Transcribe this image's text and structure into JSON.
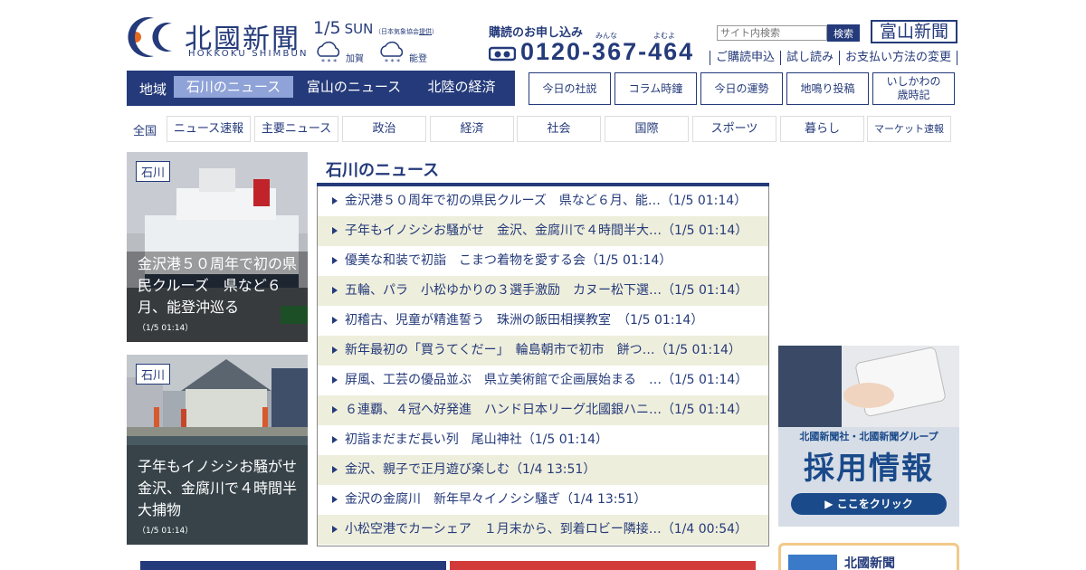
{
  "header": {
    "logo_title": "北國新聞",
    "logo_roman": "HOKKOKU SHIMBUN",
    "date": "1/5",
    "day_of_week": "SUN",
    "weather_note_prefix": "（日本気象協会",
    "weather_note_link": "提供",
    "weather_note_suffix": "）",
    "weather": [
      {
        "area": "加賀",
        "icon": "cloud-snow-icon"
      },
      {
        "area": "能登",
        "icon": "cloud-snow-icon"
      }
    ],
    "subscription_label": "購読のお申し込み",
    "phone_ruby_left": "みんな",
    "phone_ruby_right": "よむよ",
    "phone_icon": "freedial-icon",
    "phone_number": "0120-367-464",
    "search_placeholder": "サイト内検索",
    "search_button": "検索",
    "toyama_button": "富山新聞",
    "sub_links": [
      "ご購読申込",
      "試し読み",
      "お支払い方法の変更"
    ]
  },
  "region_nav": {
    "label": "地域",
    "tabs": [
      {
        "label": "石川のニュース",
        "active": true
      },
      {
        "label": "富山のニュース",
        "active": false
      },
      {
        "label": "北陸の経済",
        "active": false
      }
    ]
  },
  "top_buttons": [
    "今日の社説",
    "コラム時鐘",
    "今日の運勢",
    "地鳴り投稿",
    "いしかわの\n歳時記"
  ],
  "category_nav": {
    "all": "全国",
    "items": [
      "ニュース速報",
      "主要ニュース",
      "政治",
      "経済",
      "社会",
      "国際",
      "スポーツ",
      "暮らし",
      "マーケット速報"
    ]
  },
  "features": [
    {
      "tag": "石川",
      "caption": "金沢港５０周年で初の県民クルーズ　県など６月、能登沖巡る",
      "time": "（1/5 01:14）"
    },
    {
      "tag": "石川",
      "caption": "子年もイノシシお騒がせ　金沢、金腐川で４時間半大捕物",
      "time": "（1/5 01:14）"
    }
  ],
  "news": {
    "title": "石川のニュース",
    "items": [
      "金沢港５０周年で初の県民クルーズ　県など６月、能…（1/5 01:14）",
      "子年もイノシシお騒がせ　金沢、金腐川で４時間半大…（1/5 01:14）",
      "優美な和装で初詣　こまつ着物を愛する会（1/5 01:14）",
      "五輪、パラ　小松ゆかりの３選手激励　カヌー松下選…（1/5 01:14）",
      "初稽古、児童が精進誓う　珠洲の飯田相撲教室　（1/5 01:14）",
      "新年最初の「買うてくだー」　輪島朝市で初市　餅つ…（1/5 01:14）",
      "屏風、工芸の優品並ぶ　県立美術館で企画展始まる　…（1/5 01:14）",
      "６連覇、４冠へ好発進　ハンド日本リーグ北國銀ハニ…（1/5 01:14）",
      "初詣まだまだ長い列　尾山神社（1/5 01:14）",
      "金沢、親子で正月遊び楽しむ（1/4 13:51）",
      "金沢の金腐川　新年早々イノシシ騒ぎ（1/4 13:51）",
      "小松空港でカーシェア　１月末から、到着ロビー隣接…（1/4 00:54）"
    ]
  },
  "ad": {
    "line1": "北國新聞社・北國新聞グループ",
    "line2": "採用情報",
    "cta": "▶ ここをクリック"
  },
  "promo": {
    "text": "北國新聞"
  },
  "colors": {
    "brand": "#243a7a",
    "accent": "#8fa3d8",
    "row_alt": "#eeeedc"
  }
}
